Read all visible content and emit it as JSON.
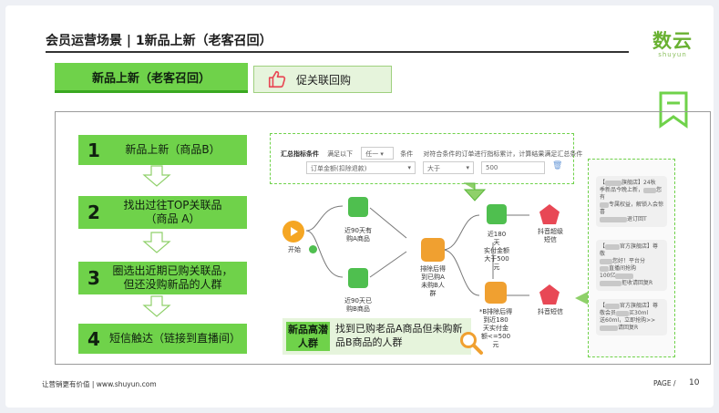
{
  "header": {
    "title": "会员运营场景 | 1新品上新（老客召回）",
    "logo_main": "数云",
    "logo_sub": "shuyun"
  },
  "tabs": {
    "main_label": "新品上新（老客召回）",
    "sub_label": "促关联回购"
  },
  "steps": [
    {
      "num": "1",
      "line1": "新品上新（商品B）",
      "line2": ""
    },
    {
      "num": "2",
      "line1": "找出过往TOP关联品",
      "line2": "（商品 A）"
    },
    {
      "num": "3",
      "line1": "圈选出近期已购关联品，",
      "line2": "但还没购新品的人群"
    },
    {
      "num": "4",
      "line1": "短信触达（链接到直播间）",
      "line2": ""
    }
  ],
  "screenshot": {
    "cond_label": "汇总指标条件",
    "cond_mode": "满足以下",
    "cond_any": "任一",
    "cond_unit": "条件",
    "cond_desc": "对符合条件的订单进行指标累计，计算结果满足汇总条件",
    "field": "订单金额(扣除退款)",
    "operator": "大于",
    "value": "500",
    "start": "开始",
    "node_a_1": "近90天有",
    "node_a_2": "购A商品",
    "node_b_1": "近90天已",
    "node_b_2": "购B商品",
    "node_mid_1": "排除后得",
    "node_mid_2": "到已购A",
    "node_mid_3": "未购B人",
    "node_mid_4": "群",
    "node_c_1": "近180",
    "node_c_2": "天",
    "node_c_3": "实付金额",
    "node_c_4": "大于500",
    "node_c_5": "元",
    "node_d_1": "*B排除后得",
    "node_d_2": "到近180",
    "node_d_3": "天实付金",
    "node_d_4": "额<=500",
    "node_d_5": "元",
    "sms_1": "抖音超级",
    "sms_2": "短信",
    "douyin": "抖音短信"
  },
  "phone": {
    "msg1_a": "【",
    "msg1_b": "旗舰店】24秋",
    "msg1_c": "季新品今晚上新，",
    "msg1_d": "您有",
    "msg1_e": "专属权益，解锁入会惊喜",
    "msg1_f": "退订回T",
    "msg2_a": "【",
    "msg2_b": "官方旗舰店】尊敬",
    "msg2_c": "您好！平台分",
    "msg2_d": "直播间抢购",
    "msg2_e": "100亿",
    "msg2_f": "拒收请回复R",
    "msg3_a": "【",
    "msg3_b": "官方旗舰店】尊",
    "msg3_c": "敬会员",
    "msg3_d": "买30ml",
    "msg3_e": "送60ml，立即抢购>>",
    "msg3_f": "请回复R"
  },
  "target": {
    "label": "新品高潜人群",
    "text": "找到已购老品A商品但未购新品B商品的人群"
  },
  "footer": {
    "left": "让营销更有价值 | www.shuyun.com",
    "page_label": "PAGE /",
    "page_num": "10"
  },
  "colors": {
    "accent_green": "#6fd24a",
    "dark_green": "#3aa820",
    "light_green": "#e6f4dc",
    "logo_green": "#69b132",
    "orange": "#f0a030",
    "red": "#e84855"
  }
}
